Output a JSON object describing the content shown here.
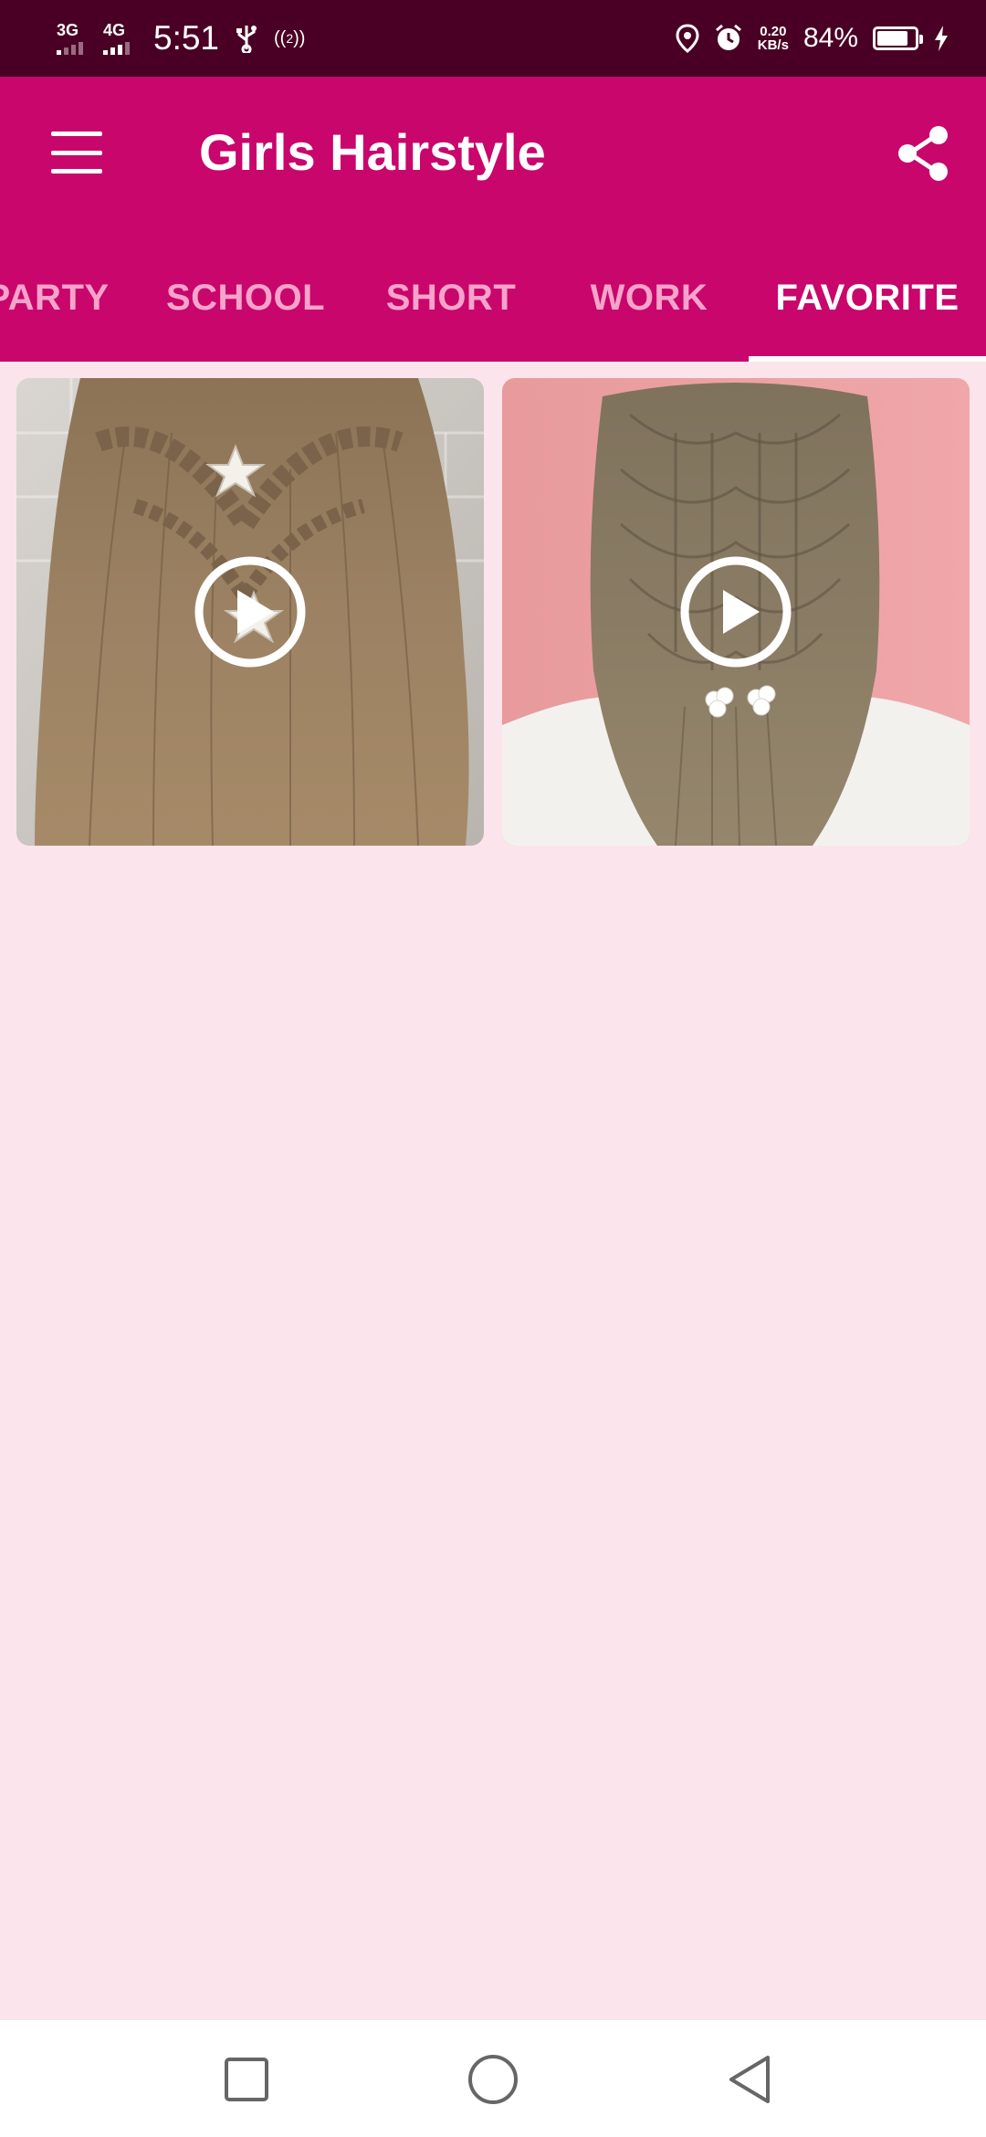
{
  "status_bar": {
    "network1": "3G",
    "network2": "4G",
    "time": "5:51",
    "hotspot_label": "2",
    "speed_value": "0.20",
    "speed_unit": "KB/s",
    "battery_pct": "84%",
    "battery_level": 0.84
  },
  "app_bar": {
    "title": "Girls Hairstyle"
  },
  "tabs": [
    {
      "label": "PARTY"
    },
    {
      "label": "SCHOOL"
    },
    {
      "label": "SHORT"
    },
    {
      "label": "WORK"
    },
    {
      "label": "FAVORITE",
      "active": true
    }
  ],
  "colors": {
    "status_bar": "#4a0024",
    "primary": "#c8066c",
    "tab_inactive": "#f7a3cb",
    "background": "#fbe4ec"
  },
  "videos": [
    {
      "icon": "play-icon"
    },
    {
      "icon": "play-icon"
    }
  ],
  "nav": {
    "recents_icon": "square-icon",
    "home_icon": "circle-icon",
    "back_icon": "triangle-back-icon"
  }
}
